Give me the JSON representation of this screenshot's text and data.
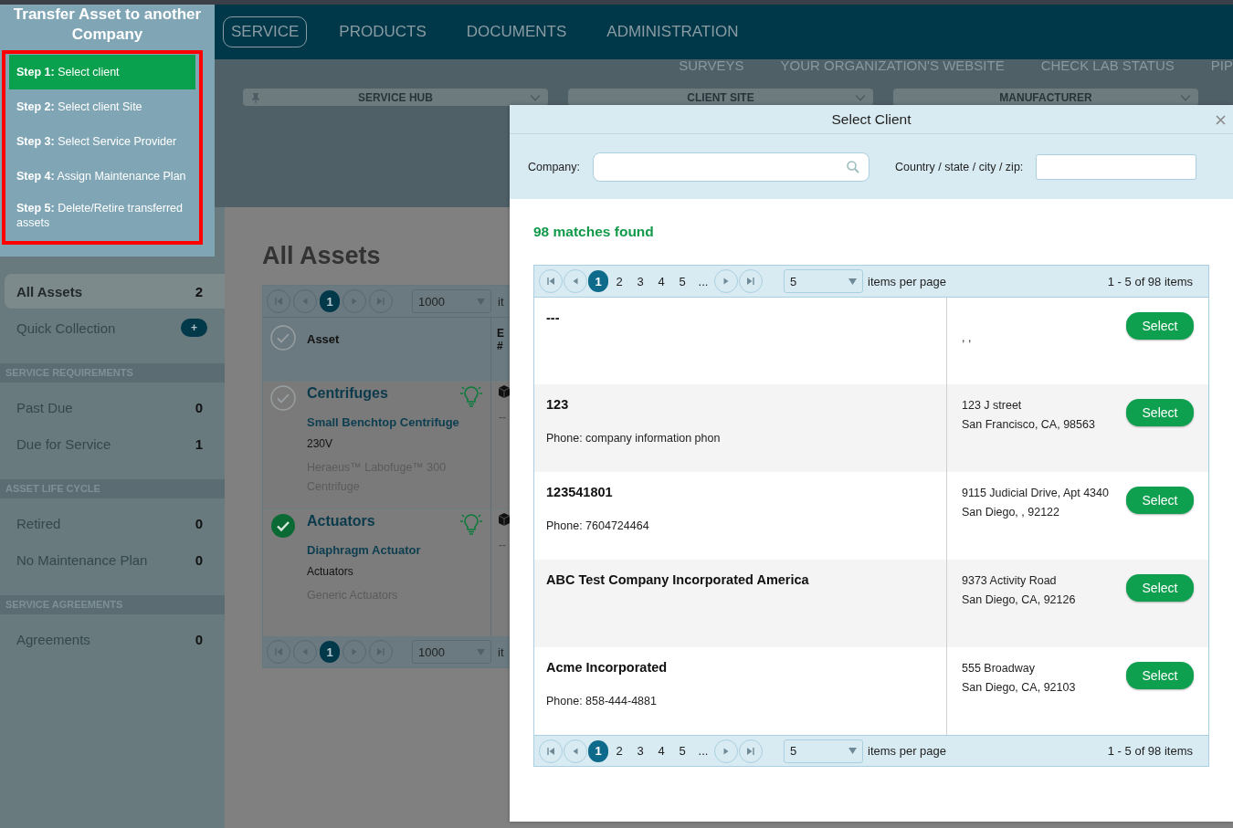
{
  "header": {
    "nav": [
      {
        "label": "SERVICE",
        "selected": true
      },
      {
        "label": "PRODUCTS",
        "selected": false
      },
      {
        "label": "DOCUMENTS",
        "selected": false
      },
      {
        "label": "ADMINISTRATION",
        "selected": false
      }
    ],
    "links": [
      "SURVEYS",
      "YOUR ORGANIZATION'S WEBSITE",
      "CHECK LAB STATUS",
      "PIP"
    ],
    "filters": [
      {
        "label": "SERVICE HUB",
        "pinned": true
      },
      {
        "label": "CLIENT SITE",
        "pinned": false
      },
      {
        "label": "MANUFACTURER",
        "pinned": false
      }
    ]
  },
  "wizard": {
    "title": "Transfer Asset to another Company",
    "steps": [
      {
        "text": "**Step 1:** Select client",
        "selected": true
      },
      {
        "text": "**Step 2:** Select client Site",
        "selected": false
      },
      {
        "text": "**Step 3:** Select Service Provider",
        "selected": false
      },
      {
        "text": "**Step 4:** Assign Maintenance Plan",
        "selected": false
      },
      {
        "text": "**Step 5:** Delete/Retire transferred assets",
        "selected": false
      }
    ]
  },
  "sidebar": {
    "items": [
      {
        "kind": "filter",
        "label": "All Assets",
        "count": "2",
        "selected": true
      },
      {
        "kind": "action",
        "label": "Quick Collection",
        "button": "+"
      },
      {
        "kind": "heading",
        "label": "SERVICE REQUIREMENTS"
      },
      {
        "kind": "filter",
        "label": "Past Due",
        "count": "0",
        "selected": false
      },
      {
        "kind": "filter",
        "label": "Due for Service",
        "count": "1",
        "selected": false
      },
      {
        "kind": "heading",
        "label": "ASSET LIFE CYCLE"
      },
      {
        "kind": "filter",
        "label": "Retired",
        "count": "0",
        "selected": false
      },
      {
        "kind": "filter",
        "label": "No Maintenance Plan",
        "count": "0",
        "selected": false
      },
      {
        "kind": "heading",
        "label": "SERVICE AGREEMENTS"
      },
      {
        "kind": "filter",
        "label": "Agreements",
        "count": "0",
        "selected": false
      }
    ]
  },
  "main": {
    "title": "All Assets",
    "table": {
      "pager_top": {
        "pages": [
          {
            "label": "1",
            "selected": true
          }
        ],
        "per_page": "1000",
        "per_page_label": "it"
      },
      "columns": [
        "Asset",
        "E #"
      ],
      "rows": [
        {
          "checked": false,
          "category": "Centrifuges",
          "name": "Small Benchtop Centrifuge",
          "detail": "230V",
          "model": "Heraeus™ Labofuge™ 300 Centrifuge",
          "column_2": "--"
        },
        {
          "checked": true,
          "category": "Actuators",
          "name": "Diaphragm Actuator",
          "detail": "Actuators",
          "model": "Generic Actuators",
          "column_2": "--"
        }
      ],
      "pager_bottom": {
        "pages": [
          {
            "label": "1",
            "selected": true
          }
        ],
        "per_page": "1000",
        "per_page_label": "it"
      }
    }
  },
  "modal": {
    "title": "Select Client",
    "filters": [
      {
        "label": "Company:",
        "kind": "search"
      },
      {
        "label": "Country / state / city / zip:",
        "kind": "text"
      }
    ],
    "matches": "98 matches found",
    "pager_top": {
      "pages": [
        {
          "label": "1",
          "selected": true
        },
        {
          "label": "2",
          "selected": false
        },
        {
          "label": "3",
          "selected": false
        },
        {
          "label": "4",
          "selected": false
        },
        {
          "label": "5",
          "selected": false
        },
        {
          "label": "...",
          "selected": false
        }
      ],
      "per_page": "5",
      "per_page_label": "items per page",
      "range": "1 - 5 of 98 items"
    },
    "rows": [
      {
        "name": "---",
        "city": ", ,",
        "button": "Select"
      },
      {
        "name": "123",
        "phone": "Phone: company information phon",
        "street": "123 J street",
        "city": "San Francisco, CA, 98563",
        "button": "Select"
      },
      {
        "name": "123541801",
        "phone": "Phone: 7604724464",
        "street": "9115 Judicial Drive, Apt 4340",
        "city": "San Diego, , 92122",
        "button": "Select"
      },
      {
        "name": "ABC Test Company Incorporated America",
        "street": "9373 Activity Road",
        "city": "San Diego, CA, 92126",
        "button": "Select"
      },
      {
        "name": "Acme Incorporated",
        "phone": "Phone: 858-444-4881",
        "street": "555 Broadway",
        "city": "San Diego, CA, 92103",
        "button": "Select"
      }
    ],
    "pager_bottom": {
      "pages": [
        {
          "label": "1",
          "selected": true
        },
        {
          "label": "2",
          "selected": false
        },
        {
          "label": "3",
          "selected": false
        },
        {
          "label": "4",
          "selected": false
        },
        {
          "label": "5",
          "selected": false
        },
        {
          "label": "...",
          "selected": false
        }
      ],
      "per_page": "5",
      "per_page_label": "items per page",
      "range": "1 - 5 of 98 items"
    }
  }
}
